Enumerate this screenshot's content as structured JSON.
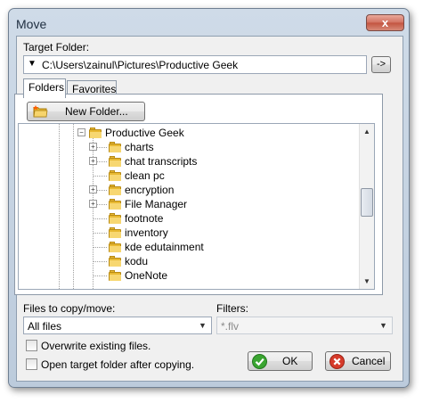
{
  "window": {
    "title": "Move",
    "close_glyph": "x"
  },
  "target": {
    "label": "Target Folder:",
    "path": "C:\\Users\\zainul\\Pictures\\Productive Geek",
    "go_label": "->"
  },
  "tabs": [
    {
      "label": "Folders",
      "active": true
    },
    {
      "label": "Favorites",
      "active": false
    }
  ],
  "new_folder_label": "New Folder...",
  "tree": {
    "root": "Productive Geek",
    "children": [
      {
        "label": "charts",
        "expandable": true
      },
      {
        "label": "chat transcripts",
        "expandable": true
      },
      {
        "label": "clean pc",
        "expandable": false
      },
      {
        "label": "encryption",
        "expandable": true
      },
      {
        "label": "File Manager",
        "expandable": true
      },
      {
        "label": "footnote",
        "expandable": false
      },
      {
        "label": "inventory",
        "expandable": false
      },
      {
        "label": "kde edutainment",
        "expandable": false
      },
      {
        "label": "kodu",
        "expandable": false
      },
      {
        "label": "OneNote",
        "expandable": false
      }
    ]
  },
  "files": {
    "label": "Files to copy/move:",
    "value": "All files"
  },
  "filters": {
    "label": "Filters:",
    "value": "*.flv"
  },
  "options": {
    "overwrite": {
      "label": "Overwrite existing files.",
      "checked": false
    },
    "open_target": {
      "label": "Open target folder after copying.",
      "checked": false
    }
  },
  "buttons": {
    "ok": "OK",
    "cancel": "Cancel"
  },
  "colors": {
    "ok_icon": "#3aa531",
    "cancel_icon": "#d63a2a",
    "folder": "#e8b932"
  }
}
